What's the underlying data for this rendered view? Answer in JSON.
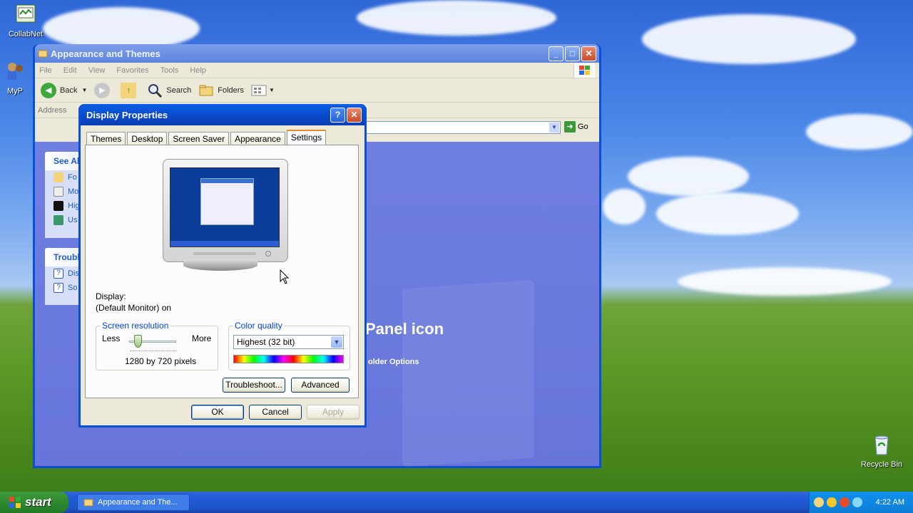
{
  "desktop": {
    "icons": [
      {
        "label": "CollabNet"
      },
      {
        "label": "MyP"
      },
      {
        "label": "Recycle Bin"
      }
    ]
  },
  "explorer": {
    "title": "Appearance and Themes",
    "menu": [
      "File",
      "Edit",
      "View",
      "Favorites",
      "Tools",
      "Help"
    ],
    "toolbar": {
      "back": "Back",
      "search": "Search",
      "folders": "Folders"
    },
    "address_label": "Address",
    "go_label": "Go",
    "see_also": {
      "header": "See Als",
      "items": [
        "Fo",
        "Mo",
        "Hig",
        "Us"
      ]
    },
    "troubleshooters": {
      "header": "Troubl",
      "items": [
        "Dis",
        "So"
      ]
    },
    "heading": "Panel icon",
    "link": "older Options"
  },
  "dialog": {
    "title": "Display Properties",
    "tabs": [
      "Themes",
      "Desktop",
      "Screen Saver",
      "Appearance",
      "Settings"
    ],
    "active_tab": "Settings",
    "display_label": "Display:",
    "display_value": "(Default Monitor) on",
    "resolution": {
      "legend": "Screen resolution",
      "less": "Less",
      "more": "More",
      "value": "1280 by 720 pixels"
    },
    "color_quality": {
      "legend": "Color quality",
      "selected": "Highest (32 bit)"
    },
    "buttons": {
      "troubleshoot": "Troubleshoot...",
      "advanced": "Advanced",
      "ok": "OK",
      "cancel": "Cancel",
      "apply": "Apply"
    }
  },
  "taskbar": {
    "start": "start",
    "task": "Appearance and The...",
    "clock": "4:22 AM"
  },
  "colors": {
    "xp_blue": "#0a4fd8",
    "start_green": "#2f8a2f",
    "tray_blue": "#0c7ed9"
  }
}
